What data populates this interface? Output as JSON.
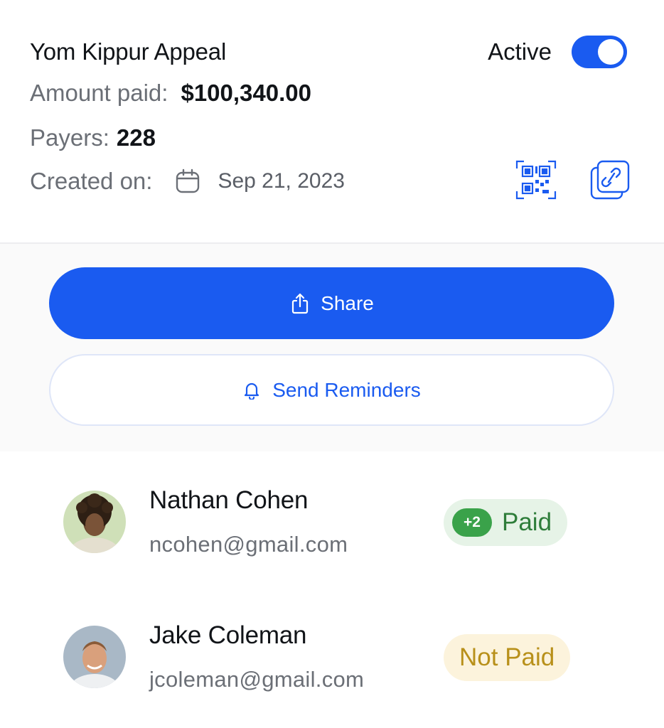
{
  "campaign": {
    "title": "Yom Kippur Appeal",
    "status_label": "Active",
    "toggle_on": true,
    "amount_label": "Amount paid:",
    "amount_value": "$100,340.00",
    "payers_label": "Payers:",
    "payers_value": "228",
    "created_label": "Created on:",
    "created_value": "Sep 21, 2023",
    "icons": {
      "calendar": "calendar-icon",
      "qr": "qr-code-icon",
      "link": "copy-link-icon"
    }
  },
  "actions": {
    "share_label": "Share",
    "share_icon": "share-icon",
    "remind_label": "Send Reminders",
    "remind_icon": "bell-icon"
  },
  "payers": [
    {
      "name": "Nathan Cohen",
      "email": "ncohen@gmail.com",
      "extra": "+2",
      "status": "Paid"
    },
    {
      "name": "Jake Coleman",
      "email": "jcoleman@gmail.com",
      "status": "Not Paid"
    }
  ],
  "colors": {
    "accent": "#1a5bf0",
    "paid_bg": "#e6f3e7",
    "paid_text": "#2e7d3a",
    "notpaid_bg": "#fcf3dc",
    "notpaid_text": "#b8901a"
  }
}
